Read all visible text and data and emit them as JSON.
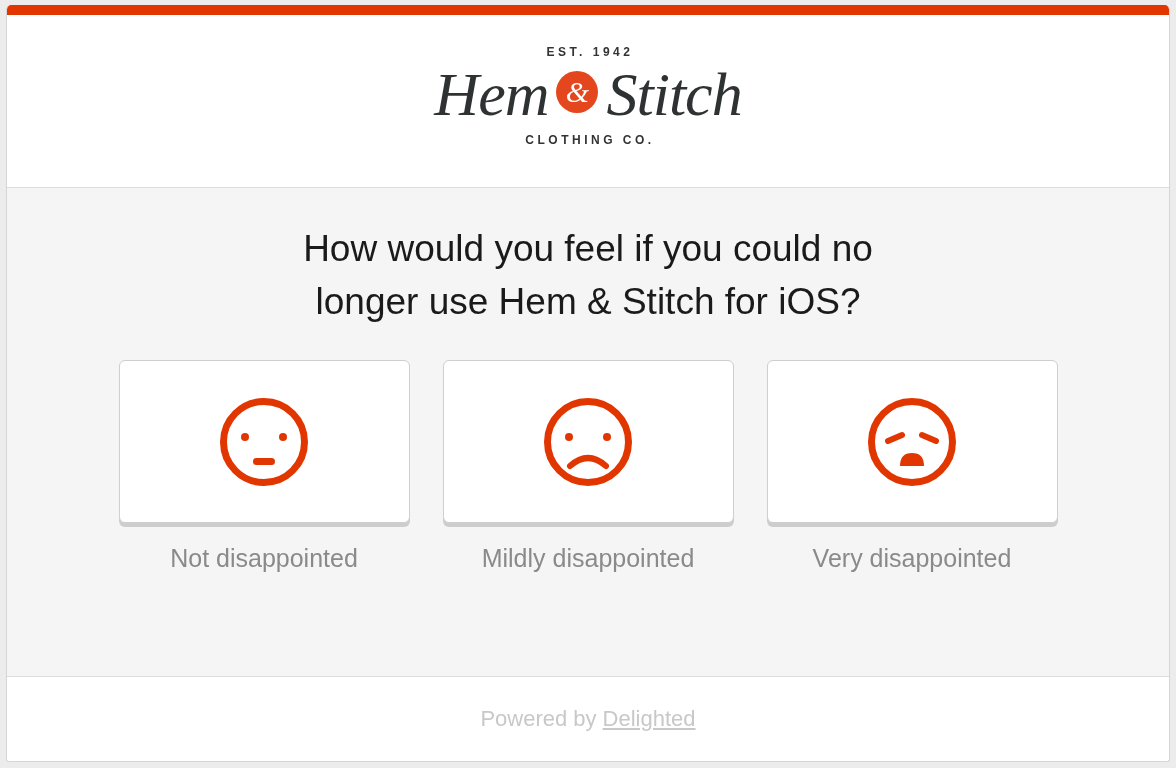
{
  "logo": {
    "tagline_top": "EST. 1942",
    "name_left": "Hem",
    "ampersand": "&",
    "name_right": "Stitch",
    "tagline_bottom": "CLOTHING CO."
  },
  "question": "How would you feel if you could no longer use Hem & Stitch for iOS?",
  "options": [
    {
      "kind": "neutral",
      "label": "Not disappointed"
    },
    {
      "kind": "sad",
      "label": "Mildly disappointed"
    },
    {
      "kind": "distressed",
      "label": "Very disappointed"
    }
  ],
  "footer": {
    "text": "Powered by",
    "link": "Delighted"
  }
}
